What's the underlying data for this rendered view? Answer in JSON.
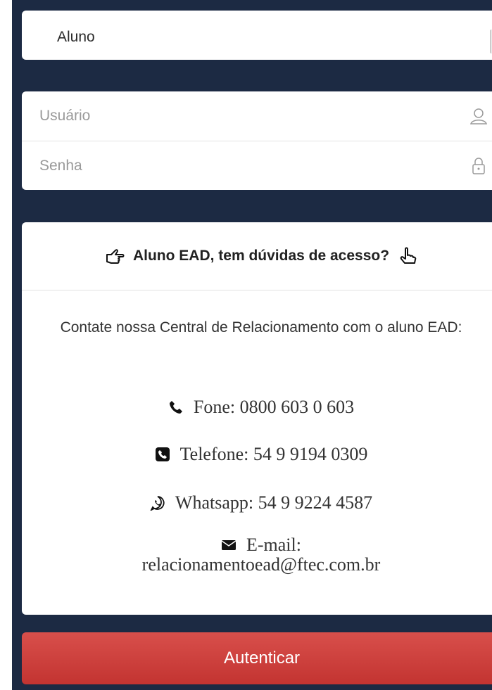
{
  "login": {
    "profile_select": {
      "value": "Aluno"
    },
    "username": {
      "placeholder": "Usuário"
    },
    "password": {
      "placeholder": "Senha"
    },
    "help": {
      "title": "Aluno EAD, tem dúvidas de acesso?",
      "intro": "Contate nossa Central de Relacionamento com o aluno EAD:",
      "phone": "Fone: 0800 603 0 603",
      "telephone": "Telefone: 54 9 9194 0309",
      "whatsapp": "Whatsapp: 54 9 9224 4587",
      "email_label": "E-mail:",
      "email_value": "relacionamentoead@ftec.com.br"
    },
    "submit_label": "Autenticar"
  },
  "colors": {
    "background": "#1c2a43",
    "button": "#c9403c",
    "panel": "#ffffff"
  },
  "icons": {
    "username": "user-icon",
    "password": "lock-icon",
    "title_left": "hand-point-right-icon",
    "title_right": "hand-point-up-icon",
    "phone": "phone-icon",
    "telephone": "phone-square-icon",
    "whatsapp": "whatsapp-icon",
    "email": "envelope-icon"
  }
}
